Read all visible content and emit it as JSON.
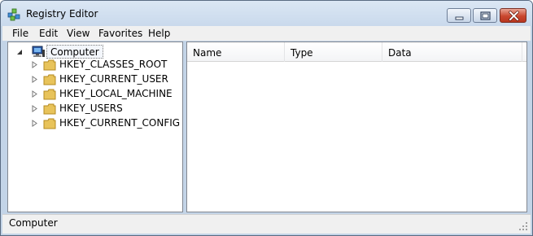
{
  "window": {
    "title": "Registry Editor",
    "icons": {
      "app": "registry-editor-icon",
      "minimize": "minimize-icon",
      "maximize": "maximize-icon",
      "close": "close-icon"
    }
  },
  "menu": {
    "items": [
      "File",
      "Edit",
      "View",
      "Favorites",
      "Help"
    ]
  },
  "tree": {
    "root": {
      "label": "Computer",
      "icon": "computer-icon",
      "expanded": true,
      "selected": true
    },
    "keys": [
      {
        "label": "HKEY_CLASSES_ROOT",
        "icon": "folder-icon"
      },
      {
        "label": "HKEY_CURRENT_USER",
        "icon": "folder-icon"
      },
      {
        "label": "HKEY_LOCAL_MACHINE",
        "icon": "folder-icon"
      },
      {
        "label": "HKEY_USERS",
        "icon": "folder-icon"
      },
      {
        "label": "HKEY_CURRENT_CONFIG",
        "icon": "folder-icon"
      }
    ]
  },
  "values_list": {
    "columns": [
      "Name",
      "Type",
      "Data"
    ],
    "rows": []
  },
  "status": {
    "text": "Computer"
  },
  "colors": {
    "frame": "#c3d4e7",
    "close_button": "#c9472f",
    "folder": "#e8c35a"
  }
}
